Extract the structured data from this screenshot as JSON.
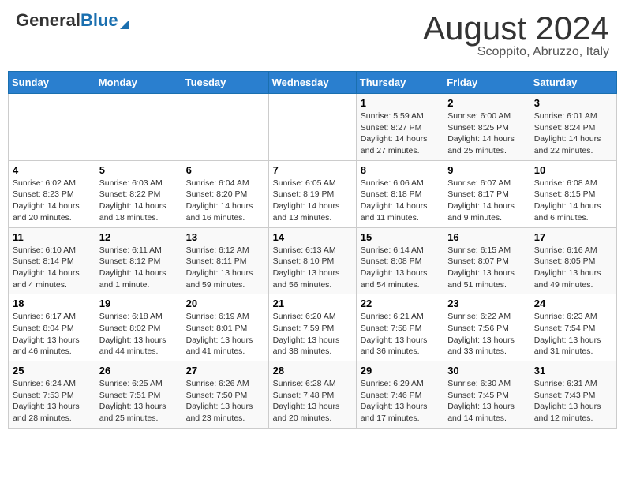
{
  "logo": {
    "general": "General",
    "blue": "Blue"
  },
  "header": {
    "month_year": "August 2024",
    "location": "Scoppito, Abruzzo, Italy"
  },
  "days_of_week": [
    "Sunday",
    "Monday",
    "Tuesday",
    "Wednesday",
    "Thursday",
    "Friday",
    "Saturday"
  ],
  "weeks": [
    [
      {
        "day": "",
        "info": ""
      },
      {
        "day": "",
        "info": ""
      },
      {
        "day": "",
        "info": ""
      },
      {
        "day": "",
        "info": ""
      },
      {
        "day": "1",
        "info": "Sunrise: 5:59 AM\nSunset: 8:27 PM\nDaylight: 14 hours and 27 minutes."
      },
      {
        "day": "2",
        "info": "Sunrise: 6:00 AM\nSunset: 8:25 PM\nDaylight: 14 hours and 25 minutes."
      },
      {
        "day": "3",
        "info": "Sunrise: 6:01 AM\nSunset: 8:24 PM\nDaylight: 14 hours and 22 minutes."
      }
    ],
    [
      {
        "day": "4",
        "info": "Sunrise: 6:02 AM\nSunset: 8:23 PM\nDaylight: 14 hours and 20 minutes."
      },
      {
        "day": "5",
        "info": "Sunrise: 6:03 AM\nSunset: 8:22 PM\nDaylight: 14 hours and 18 minutes."
      },
      {
        "day": "6",
        "info": "Sunrise: 6:04 AM\nSunset: 8:20 PM\nDaylight: 14 hours and 16 minutes."
      },
      {
        "day": "7",
        "info": "Sunrise: 6:05 AM\nSunset: 8:19 PM\nDaylight: 14 hours and 13 minutes."
      },
      {
        "day": "8",
        "info": "Sunrise: 6:06 AM\nSunset: 8:18 PM\nDaylight: 14 hours and 11 minutes."
      },
      {
        "day": "9",
        "info": "Sunrise: 6:07 AM\nSunset: 8:17 PM\nDaylight: 14 hours and 9 minutes."
      },
      {
        "day": "10",
        "info": "Sunrise: 6:08 AM\nSunset: 8:15 PM\nDaylight: 14 hours and 6 minutes."
      }
    ],
    [
      {
        "day": "11",
        "info": "Sunrise: 6:10 AM\nSunset: 8:14 PM\nDaylight: 14 hours and 4 minutes."
      },
      {
        "day": "12",
        "info": "Sunrise: 6:11 AM\nSunset: 8:12 PM\nDaylight: 14 hours and 1 minute."
      },
      {
        "day": "13",
        "info": "Sunrise: 6:12 AM\nSunset: 8:11 PM\nDaylight: 13 hours and 59 minutes."
      },
      {
        "day": "14",
        "info": "Sunrise: 6:13 AM\nSunset: 8:10 PM\nDaylight: 13 hours and 56 minutes."
      },
      {
        "day": "15",
        "info": "Sunrise: 6:14 AM\nSunset: 8:08 PM\nDaylight: 13 hours and 54 minutes."
      },
      {
        "day": "16",
        "info": "Sunrise: 6:15 AM\nSunset: 8:07 PM\nDaylight: 13 hours and 51 minutes."
      },
      {
        "day": "17",
        "info": "Sunrise: 6:16 AM\nSunset: 8:05 PM\nDaylight: 13 hours and 49 minutes."
      }
    ],
    [
      {
        "day": "18",
        "info": "Sunrise: 6:17 AM\nSunset: 8:04 PM\nDaylight: 13 hours and 46 minutes."
      },
      {
        "day": "19",
        "info": "Sunrise: 6:18 AM\nSunset: 8:02 PM\nDaylight: 13 hours and 44 minutes."
      },
      {
        "day": "20",
        "info": "Sunrise: 6:19 AM\nSunset: 8:01 PM\nDaylight: 13 hours and 41 minutes."
      },
      {
        "day": "21",
        "info": "Sunrise: 6:20 AM\nSunset: 7:59 PM\nDaylight: 13 hours and 38 minutes."
      },
      {
        "day": "22",
        "info": "Sunrise: 6:21 AM\nSunset: 7:58 PM\nDaylight: 13 hours and 36 minutes."
      },
      {
        "day": "23",
        "info": "Sunrise: 6:22 AM\nSunset: 7:56 PM\nDaylight: 13 hours and 33 minutes."
      },
      {
        "day": "24",
        "info": "Sunrise: 6:23 AM\nSunset: 7:54 PM\nDaylight: 13 hours and 31 minutes."
      }
    ],
    [
      {
        "day": "25",
        "info": "Sunrise: 6:24 AM\nSunset: 7:53 PM\nDaylight: 13 hours and 28 minutes."
      },
      {
        "day": "26",
        "info": "Sunrise: 6:25 AM\nSunset: 7:51 PM\nDaylight: 13 hours and 25 minutes."
      },
      {
        "day": "27",
        "info": "Sunrise: 6:26 AM\nSunset: 7:50 PM\nDaylight: 13 hours and 23 minutes."
      },
      {
        "day": "28",
        "info": "Sunrise: 6:28 AM\nSunset: 7:48 PM\nDaylight: 13 hours and 20 minutes."
      },
      {
        "day": "29",
        "info": "Sunrise: 6:29 AM\nSunset: 7:46 PM\nDaylight: 13 hours and 17 minutes."
      },
      {
        "day": "30",
        "info": "Sunrise: 6:30 AM\nSunset: 7:45 PM\nDaylight: 13 hours and 14 minutes."
      },
      {
        "day": "31",
        "info": "Sunrise: 6:31 AM\nSunset: 7:43 PM\nDaylight: 13 hours and 12 minutes."
      }
    ]
  ]
}
